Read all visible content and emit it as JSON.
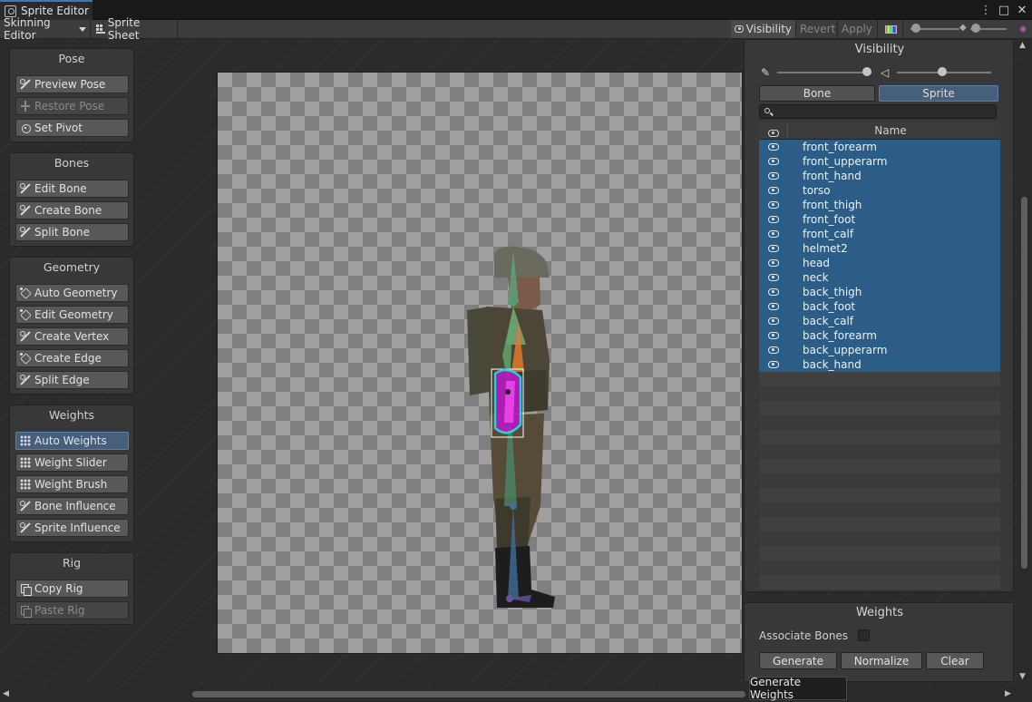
{
  "window": {
    "title": "Sprite Editor"
  },
  "toolbar": {
    "mode_dropdown": "Skinning Editor",
    "sprite_sheet": "Sprite Sheet",
    "visibility": "Visibility",
    "revert": "Revert",
    "apply": "Apply"
  },
  "panels": {
    "pose": {
      "title": "Pose",
      "buttons": [
        "Preview Pose",
        "Restore Pose",
        "Set Pivot"
      ]
    },
    "bones": {
      "title": "Bones",
      "buttons": [
        "Edit Bone",
        "Create Bone",
        "Split Bone"
      ]
    },
    "geometry": {
      "title": "Geometry",
      "buttons": [
        "Auto Geometry",
        "Edit Geometry",
        "Create Vertex",
        "Create Edge",
        "Split Edge"
      ]
    },
    "weights": {
      "title": "Weights",
      "buttons": [
        "Auto Weights",
        "Weight Slider",
        "Weight Brush",
        "Bone Influence",
        "Sprite Influence"
      ]
    },
    "rig": {
      "title": "Rig",
      "buttons": [
        "Copy Rig",
        "Paste Rig"
      ]
    }
  },
  "visibility_panel": {
    "title": "Visibility",
    "tabs": [
      "Bone",
      "Sprite"
    ],
    "active_tab": "Sprite",
    "search_placeholder": "",
    "column_name": "Name",
    "rows": [
      "front_forearm",
      "front_upperarm",
      "front_hand",
      "torso",
      "front_thigh",
      "front_foot",
      "front_calf",
      "helmet2",
      "head",
      "neck",
      "back_thigh",
      "back_foot",
      "back_calf",
      "back_forearm",
      "back_upperarm",
      "back_hand"
    ]
  },
  "weights_panel": {
    "title": "Weights",
    "associate_bones_label": "Associate Bones",
    "associate_bones_checked": false,
    "generate": "Generate",
    "normalize": "Normalize",
    "clear": "Clear"
  },
  "tooltip": "Generate Weights",
  "colors": {
    "accent": "#46607c",
    "selected_row": "#2c5d87",
    "title_accent": "#3a79bb"
  }
}
